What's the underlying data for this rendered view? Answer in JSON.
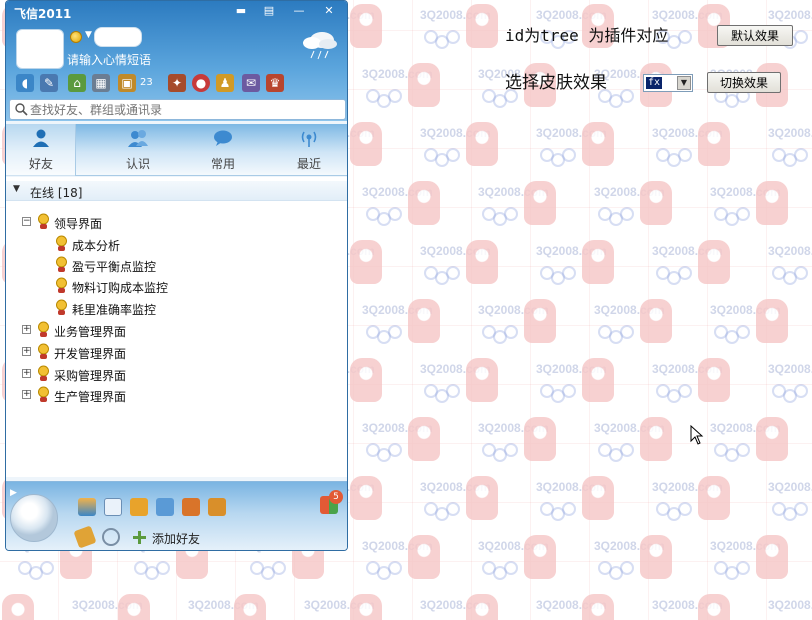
{
  "background": {
    "watermark_text": "3Q2008.com"
  },
  "fetion": {
    "title": "飞信2011",
    "window_buttons": [
      "▬",
      "▤",
      "—",
      "✕"
    ],
    "mood_placeholder": "请输入心情短语",
    "toolbar_count": "23",
    "search": {
      "placeholder": "查找好友、群组或通讯录"
    },
    "tabs": [
      {
        "label": "好友",
        "icon": "person-icon"
      },
      {
        "label": "认识",
        "icon": "people-icon"
      },
      {
        "label": "常用",
        "icon": "chat-bubble-icon"
      },
      {
        "label": "最近",
        "icon": "signal-icon"
      }
    ],
    "group": {
      "arrow": "▼",
      "label": "在线 [18]"
    },
    "tree": [
      {
        "label": "领导界面",
        "expanded": true,
        "toggle": "−",
        "children": [
          {
            "label": "成本分析"
          },
          {
            "label": "盈亏平衡点监控"
          },
          {
            "label": "物料订购成本监控"
          },
          {
            "label": "耗里准确率监控"
          }
        ]
      },
      {
        "label": "业务管理界面",
        "toggle": "+"
      },
      {
        "label": "开发管理界面",
        "toggle": "+"
      },
      {
        "label": "采购管理界面",
        "toggle": "+"
      },
      {
        "label": "生产管理界面",
        "toggle": "+"
      }
    ],
    "bottom": {
      "badge": "5",
      "add_friend_label": "添加好友"
    },
    "colors": {
      "title_blue": "#2c7bc0",
      "badge": "#e25a35"
    }
  },
  "form": {
    "tree_id_label": "id为tree 为插件对应",
    "default_effect_button": "默认效果",
    "skin_label": "选择皮肤效果",
    "skin_select_value": "fx",
    "switch_effect_button": "切换效果"
  }
}
